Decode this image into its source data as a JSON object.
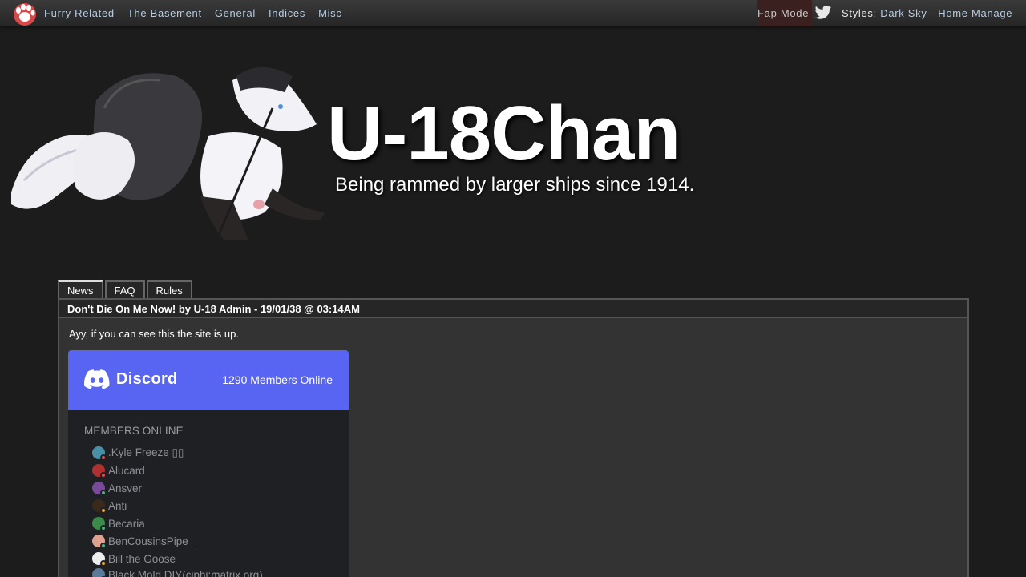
{
  "nav": {
    "links": [
      "Furry Related",
      "The Basement",
      "General",
      "Indices",
      "Misc"
    ],
    "fap_mode": "Fap Mode",
    "styles_label": "Styles:",
    "style_dark_sky": "Dark Sky",
    "separator": "-",
    "home": "Home",
    "manage": "Manage"
  },
  "header": {
    "title": "U-18Chan",
    "slogan": "Being rammed by larger ships since 1914."
  },
  "tabs": [
    "News",
    "FAQ",
    "Rules"
  ],
  "news": {
    "headline": "Don't Die On Me Now! by U-18 Admin - 19/01/38 @ 03:14AM",
    "body": "Ayy, if you can see this the site is up."
  },
  "discord": {
    "brand": "Discord",
    "members_online_count": "1290 Members Online",
    "section_label": "MEMBERS ONLINE",
    "members": [
      {
        "name": ".Kyle Freeze ▯▯",
        "avatar_color": "#4a8fa8",
        "status_color": "#f04747"
      },
      {
        "name": "Alucard",
        "avatar_color": "#b03030",
        "status_color": "#f04747"
      },
      {
        "name": "Ansver",
        "avatar_color": "#7a4a9a",
        "status_color": "#43b581"
      },
      {
        "name": "Anti",
        "avatar_color": "#3a2a1a",
        "status_color": "#faa61a"
      },
      {
        "name": "Becaria",
        "avatar_color": "#3a8a4a",
        "status_color": "#43b581"
      },
      {
        "name": "BenCousinsPipe_",
        "avatar_color": "#e0a090",
        "status_color": "#43b581"
      },
      {
        "name": "Bill the Goose",
        "avatar_color": "#eeeeee",
        "status_color": "#faa61a"
      },
      {
        "name": "Black Mold DIY(ciphi:matrix.org)",
        "avatar_color": "#5a7a9a",
        "status_color": "#43b581"
      }
    ]
  },
  "colors": {
    "discord_blurple": "#5865f2",
    "nav_link": "#b8cce0",
    "background": "#1c1c1c"
  }
}
